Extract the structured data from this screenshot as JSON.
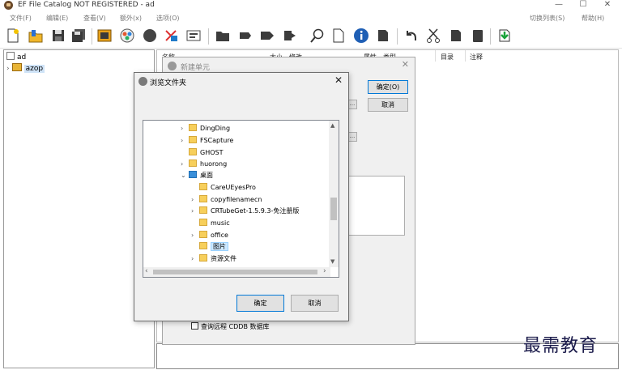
{
  "window": {
    "title": "EF File Catalog NOT REGISTERED - ad",
    "minimize": "—",
    "maximize": "☐",
    "close": "✕"
  },
  "menu": {
    "items": [
      "文件(F)",
      "编辑(E)",
      "查看(V)",
      "额外(x)",
      "选项(O)"
    ],
    "right_items": [
      "切换列表(S)",
      "帮助(H)"
    ]
  },
  "toolbar": {
    "icons": [
      "new-catalog-icon",
      "open-catalog-icon",
      "save-icon",
      "save-all-icon",
      "add-volume-icon",
      "scan-icon",
      "circle-icon",
      "tools-icon",
      "properties-icon",
      "folder-dark-icon",
      "tag-icon",
      "label-icon",
      "export-icon",
      "search-icon",
      "page-icon",
      "info-icon",
      "print-icon",
      "undo-icon",
      "cut-icon",
      "copy-icon",
      "paste-icon",
      "update-icon"
    ]
  },
  "tree": {
    "root_label": "ad",
    "child_label": "azop"
  },
  "list": {
    "columns": [
      "名称",
      "大小",
      "修改",
      "属性",
      "类型",
      "目录",
      "注释"
    ]
  },
  "new_dialog": {
    "title": "新建单元",
    "ok_label": "确定(O)",
    "cancel_label": "取消",
    "checkbox_label": "查询远程 CDDB 数据库",
    "dots_label": "..."
  },
  "browse_dialog": {
    "title": "浏览文件夹",
    "ok_label": "确定",
    "cancel_label": "取消",
    "folders": [
      {
        "label": "DingDing",
        "expand": "›"
      },
      {
        "label": "FSCapture",
        "expand": "›"
      },
      {
        "label": "GHOST",
        "expand": ""
      },
      {
        "label": "huorong",
        "expand": "›"
      },
      {
        "label": "桌面",
        "expand": "⌄"
      },
      {
        "label": "CareUEyesPro",
        "expand": ""
      },
      {
        "label": "copyfilenamecn",
        "expand": "›"
      },
      {
        "label": "CRTubeGet-1.5.9.3-免注册版",
        "expand": "›"
      },
      {
        "label": "music",
        "expand": ""
      },
      {
        "label": "office",
        "expand": "›"
      },
      {
        "label": "图片",
        "expand": ""
      },
      {
        "label": "资源文件",
        "expand": "›"
      }
    ],
    "selected_folder": "图片"
  },
  "watermark": "最需教育"
}
